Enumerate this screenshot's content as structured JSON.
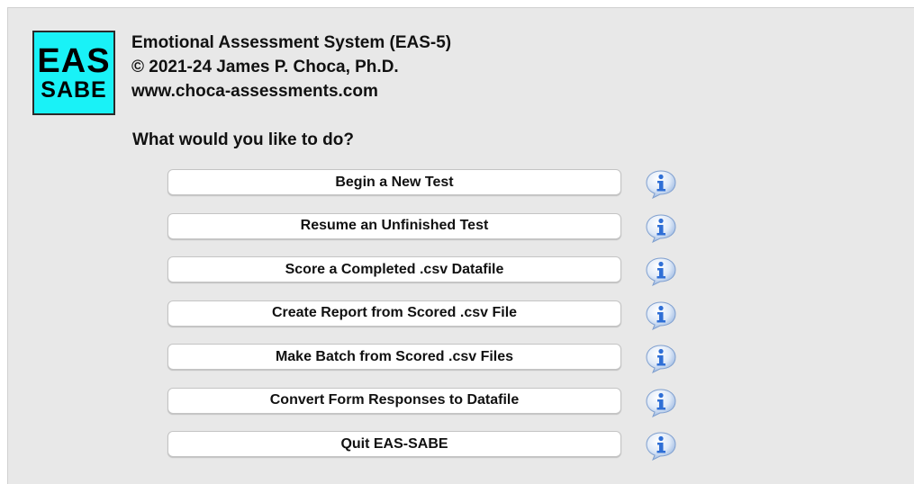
{
  "logo": {
    "line1": "EAS",
    "line2": "SABE",
    "background": "#19f2f7"
  },
  "header": {
    "title": "Emotional Assessment System (EAS-5)",
    "copyright": "© 2021-24 James P. Choca, Ph.D.",
    "website": "www.choca-assessments.com"
  },
  "prompt": "What would you like to do?",
  "menu": {
    "items": [
      {
        "label": "Begin a New Test",
        "icon": "info-icon"
      },
      {
        "label": "Resume an Unfinished Test",
        "icon": "info-icon"
      },
      {
        "label": "Score a Completed .csv Datafile",
        "icon": "info-icon"
      },
      {
        "label": "Create Report from Scored .csv File",
        "icon": "info-icon"
      },
      {
        "label": "Make Batch from Scored .csv Files",
        "icon": "info-icon"
      },
      {
        "label": "Convert Form Responses to Datafile",
        "icon": "info-icon"
      },
      {
        "label": "Quit EAS-SABE",
        "icon": "info-icon"
      }
    ]
  },
  "colors": {
    "window_background": "#e8e8e8",
    "info_icon_blue": "#2f6fd6"
  }
}
